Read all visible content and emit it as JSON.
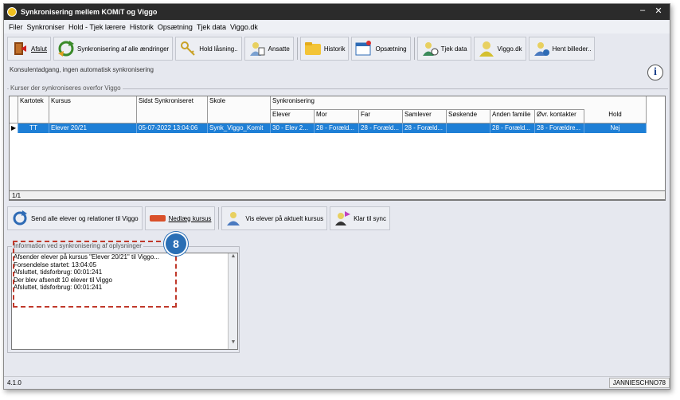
{
  "window": {
    "title": "Synkronisering mellem KOMiT og Viggo",
    "minimize": "–",
    "close": "✕"
  },
  "menu": [
    "Filer",
    "Synkroniser",
    "Hold - Tjek lærere",
    "Historik",
    "Opsætning",
    "Tjek data",
    "Viggo.dk"
  ],
  "toolbar": {
    "afslut": "Afslut",
    "synkronisering": "Synkronisering af alle ændringer",
    "hold_laasning": "Hold låsning..",
    "ansatte": "Ansatte",
    "historik": "Historik",
    "opsaetning": "Opsætning",
    "tjek_data": "Tjek data",
    "viggo_dk": "Viggo.dk",
    "hent_billeder": "Hent billeder.."
  },
  "info_text": "Konsulentadgang, ingen automatisk synkronisering",
  "info_icon": "i",
  "grid": {
    "group_label": "Kurser der synkroniseres overfor Viggo",
    "headers": {
      "kartotek": "Kartotek",
      "kursus": "Kursus",
      "sidst": "Sidst Synkroniseret",
      "skole": "Skole",
      "synkronisering": "Synkronisering",
      "elever": "Elever",
      "mor": "Mor",
      "far": "Far",
      "samlever": "Samlever",
      "soeskende": "Søskende",
      "anden_familie": "Anden familie",
      "ovr_kontakter": "Øvr. kontakter",
      "hold": "Hold"
    },
    "row": {
      "kartotek": "TT",
      "kursus": "Elever 20/21",
      "sidst": "05-07-2022 13:04:06",
      "skole": "Synk_Viggo_Komit",
      "elever": "30 - Elev 2...",
      "mor": "28 - Foræld...",
      "far": "28 - Foræld...",
      "samlever": "28 - Foræld...",
      "soeskende": "",
      "anden_familie": "28 - Foræld...",
      "ovr_kontakter": "28 - Forældre...",
      "hold": "Nej"
    },
    "footer": "1/1"
  },
  "actions": {
    "send_alle": "Send alle elever og relationer til Viggo",
    "nedlaeg": "Nedlæg kursus",
    "vis_elever": "Vis elever på aktuelt kursus",
    "klar": "Klar til sync"
  },
  "infobox": {
    "label": "Information ved synkronisering af oplysninger",
    "lines": [
      "Afsender elever på kursus \"Elever 20/21\" til Viggo...",
      "Forsendelse startet: 13:04:05",
      "Afsluttet, tidsforbrug: 00:01:241",
      "Der blev afsendt 10 elever til Viggo",
      "Afsluttet, tidsforbrug: 00:01:241"
    ]
  },
  "badge": "8",
  "status": {
    "version": "4.1.0",
    "user": "JANNIESCHNO78"
  },
  "colors": {
    "selection": "#1e7fd6",
    "callout": "#c0392b",
    "badge": "#2a6fb5"
  }
}
